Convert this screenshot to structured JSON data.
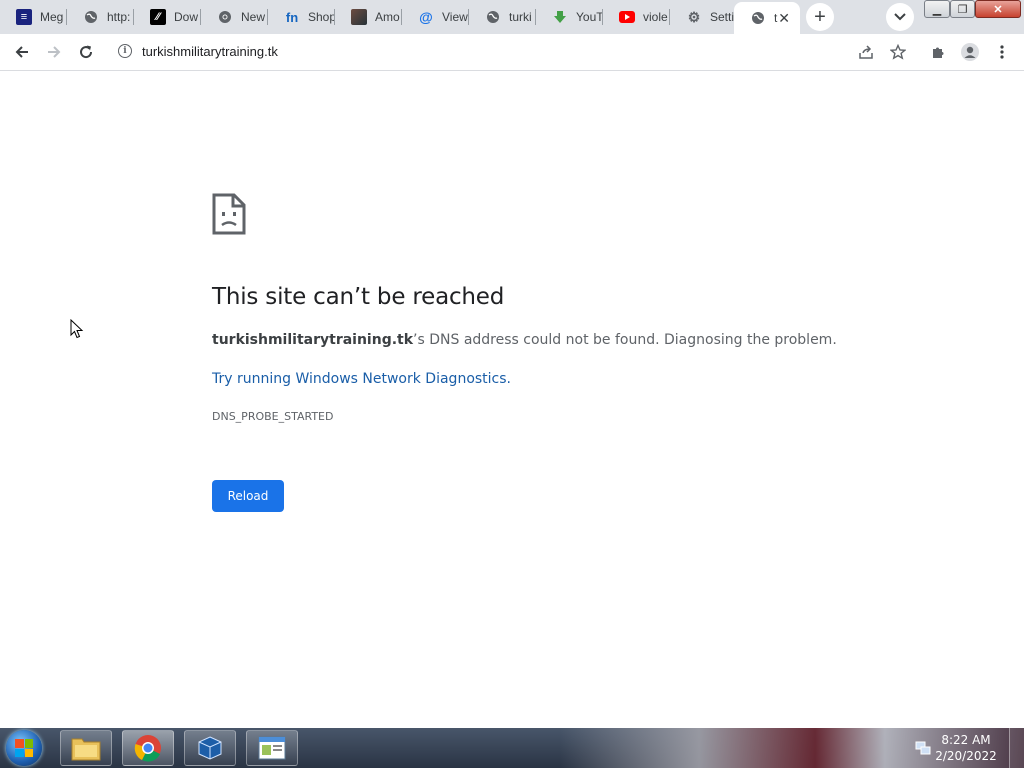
{
  "browser": {
    "tabs": [
      {
        "label": "Meg",
        "favicon": "site-logo-icon",
        "color": "#1a237e"
      },
      {
        "label": "http:",
        "favicon": "globe-icon",
        "color": "#5f6368"
      },
      {
        "label": "Dow",
        "favicon": "download-site-icon",
        "color": "#000000"
      },
      {
        "label": "New",
        "favicon": "chrome-icon",
        "color": "#5f6368"
      },
      {
        "label": "Shop",
        "favicon": "fn-logo-icon",
        "color": "#1565c0"
      },
      {
        "label": "Amo",
        "favicon": "image-thumbnail-icon",
        "color": "#6d4c41"
      },
      {
        "label": "View",
        "favicon": "at-sign-icon",
        "color": "#1a73e8"
      },
      {
        "label": "turki",
        "favicon": "globe-icon",
        "color": "#5f6368"
      },
      {
        "label": "YouT",
        "favicon": "green-arrow-icon",
        "color": "#43a047"
      },
      {
        "label": "viole",
        "favicon": "youtube-icon",
        "color": "#ff0000"
      },
      {
        "label": "Setti",
        "favicon": "gear-icon",
        "color": "#5f6368"
      }
    ],
    "active_tab": {
      "label": "t",
      "favicon": "globe-icon"
    },
    "url": "turkishmilitarytraining.tk"
  },
  "error_page": {
    "heading": "This site can’t be reached",
    "domain": "turkishmilitarytraining.tk",
    "description_suffix": "’s DNS address could not be found. Diagnosing the problem.",
    "diagnostics_link": "Try running Windows Network Diagnostics.",
    "error_code": "DNS_PROBE_STARTED",
    "reload_label": "Reload"
  },
  "taskbar": {
    "items": [
      {
        "name": "file-explorer",
        "icon": "folder-icon"
      },
      {
        "name": "chrome",
        "icon": "chrome-icon"
      },
      {
        "name": "virtualbox",
        "icon": "cube-icon"
      },
      {
        "name": "window-app",
        "icon": "window-icon"
      }
    ],
    "time": "8:22 AM",
    "date": "2/20/2022"
  },
  "colors": {
    "tabstrip": "#dee1e6",
    "link": "#1a5ea8",
    "button": "#1a73e8"
  }
}
